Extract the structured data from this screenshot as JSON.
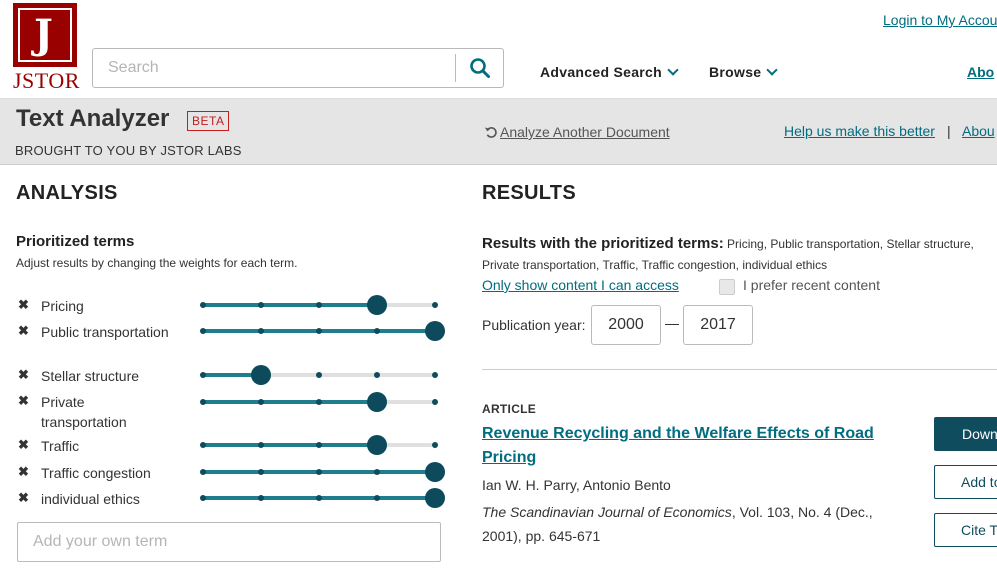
{
  "header": {
    "logo_text": "JSTOR",
    "search_placeholder": "Search",
    "nav": {
      "advanced_search": "Advanced Search",
      "browse": "Browse",
      "about": "Abo"
    },
    "login": "Login to My Accou"
  },
  "band": {
    "title": "Text Analyzer",
    "beta": "BETA",
    "subtitle": "BROUGHT TO YOU BY JSTOR LABS",
    "analyze_another": "Analyze Another Document",
    "help": "Help us make this better",
    "separator": "|",
    "about": "Abou"
  },
  "analysis": {
    "heading": "ANALYSIS",
    "prioritized_title": "Prioritized terms",
    "prioritized_sub": "Adjust results by changing the weights for each term.",
    "terms": [
      {
        "label": "Pricing",
        "weight": 4,
        "max": 5
      },
      {
        "label": "Public transportation",
        "weight": 5,
        "max": 5
      },
      {
        "label": "Stellar structure",
        "weight": 2,
        "max": 5
      },
      {
        "label": "Private transportation",
        "weight": 4,
        "max": 5
      },
      {
        "label": "Traffic",
        "weight": 4,
        "max": 5
      },
      {
        "label": "Traffic congestion",
        "weight": 5,
        "max": 5
      },
      {
        "label": "individual ethics",
        "weight": 5,
        "max": 5
      }
    ],
    "own_term_placeholder": "Add your own term"
  },
  "results": {
    "heading": "RESULTS",
    "prioritized_label": "Results with the prioritized terms:",
    "prioritized_list": "Pricing, Public transportation, Stellar structure, Private transportation, Traffic, Traffic congestion, individual ethics",
    "only_show": "Only show content I can access",
    "prefer_recent": "I prefer recent content",
    "prefer_recent_checked": false,
    "pub_year_label": "Publication year:",
    "year_from": "2000",
    "year_to": "2017",
    "article": {
      "type": "ARTICLE",
      "title": "Revenue Recycling and the Welfare Effects of Road Pricing",
      "authors": "Ian W. H. Parry, Antonio Bento",
      "journal": "The Scandinavian Journal of Economics",
      "citation": ", Vol. 103, No. 4 (Dec., 2001), pp. 645-671",
      "download": "Down",
      "add_to": "Add to",
      "cite": "Cite T"
    }
  },
  "colors": {
    "brand_red": "#990000",
    "accent_teal": "#006d81",
    "slider_dark": "#0d4a5b",
    "slider_fill": "#1f7d8d"
  }
}
